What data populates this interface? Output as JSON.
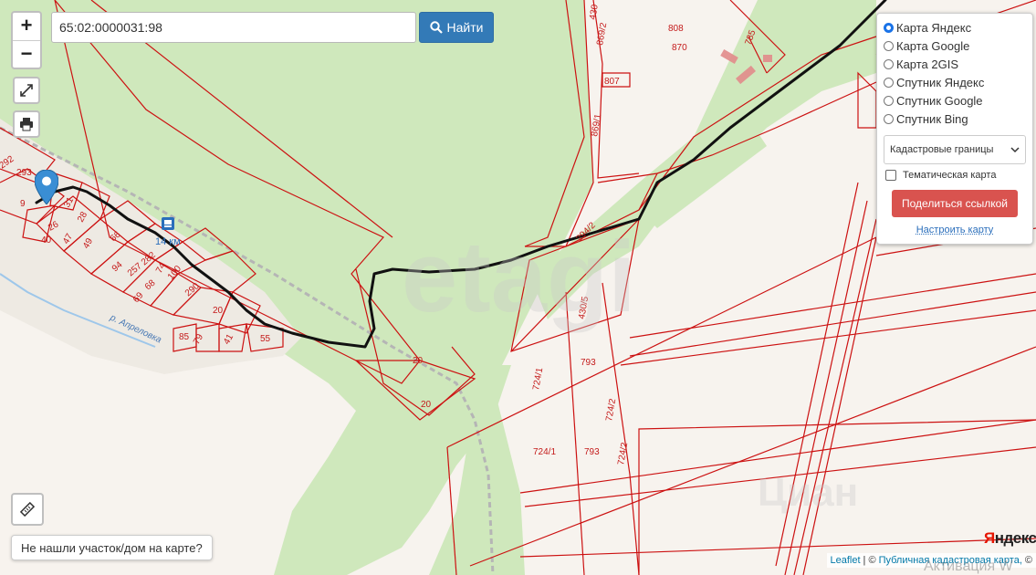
{
  "search": {
    "value": "65:02:0000031:98",
    "button_label": "Найти"
  },
  "zoom": {
    "in_label": "+",
    "out_label": "−"
  },
  "layers": {
    "options": [
      {
        "label": "Карта Яндекс",
        "selected": true
      },
      {
        "label": "Карта Google",
        "selected": false
      },
      {
        "label": "Карта 2GIS",
        "selected": false
      },
      {
        "label": "Спутник Яндекс",
        "selected": false
      },
      {
        "label": "Спутник Google",
        "selected": false
      },
      {
        "label": "Спутник Bing",
        "selected": false
      }
    ],
    "overlay_select": "Кадастровые границы",
    "thematic_label": "Тематическая карта",
    "thematic_checked": false,
    "share_label": "Поделиться ссылкой",
    "configure_label": "Настроить карту"
  },
  "not_found_label": "Не нашли участок/дом на карте?",
  "provider_logo": "Яндекс",
  "attribution": {
    "leaflet": "Leaflet",
    "separator": "| ©",
    "pkk": "Публичная кадастровая карта,",
    "copyright": "©"
  },
  "watermarks": {
    "etagi": "etagi",
    "cian": "Циан"
  },
  "activation_text": "Активация W",
  "map": {
    "station_label": "14 км",
    "river_label": "р. Апреловка",
    "parcel_labels": [
      "808",
      "870",
      "785",
      "807",
      "869/2",
      "869/1",
      "430",
      "294/2",
      "430/5",
      "793",
      "724/1",
      "724/2",
      "724/1",
      "793",
      "724/2",
      "20",
      "20",
      "292",
      "293",
      "9",
      "31",
      "26",
      "28",
      "47",
      "40",
      "49",
      "66",
      "94",
      "257",
      "282",
      "74",
      "100",
      "69",
      "68",
      "290",
      "20",
      "85",
      "79",
      "41",
      "55"
    ]
  },
  "colors": {
    "parcel_border": "#cc1111",
    "forest": "#cfe8bc",
    "track": "#111111",
    "search_button": "#337ab7",
    "share_button": "#d9534f"
  }
}
